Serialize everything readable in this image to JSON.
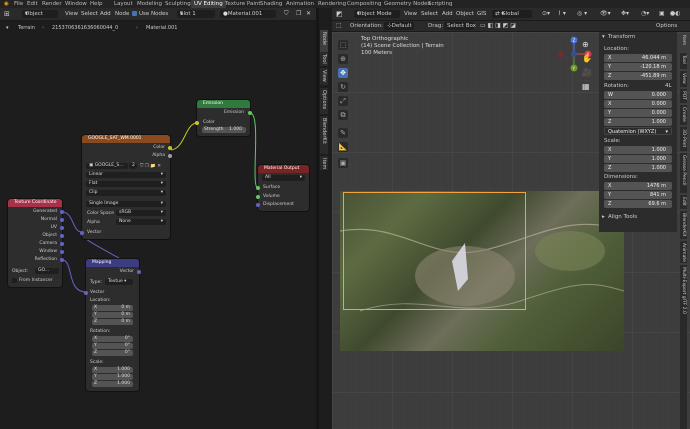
{
  "menu": {
    "file": "File",
    "edit": "Edit",
    "render": "Render",
    "window": "Window",
    "help": "Help"
  },
  "workspaces": [
    "Layout",
    "Modeling",
    "Sculpting",
    "UV Editing",
    "Texture Paint",
    "Shading",
    "Animation",
    "Rendering",
    "Compositing",
    "Geometry Nodes",
    "Scripting"
  ],
  "node_editor": {
    "header": {
      "mode": "Object",
      "view": "View",
      "select": "Select",
      "add": "Add",
      "node": "Node",
      "use_nodes": "Use Nodes",
      "slot": "Slot 1",
      "material": "Material.001"
    },
    "breadcrumb": {
      "object": "Terrain",
      "mesh": "2153706361636060044_0",
      "material": "Material.001"
    },
    "nodes": {
      "emission": {
        "title": "Emission",
        "out": "Emission",
        "color": "Color",
        "strength_label": "Strength",
        "strength": "1.000"
      },
      "image": {
        "title": "GOOGLE_SAT_WM.0001",
        "color": "Color",
        "alpha": "Alpha",
        "image_name": "GOOGLE_S...",
        "users": "2",
        "interp": "Linear",
        "proj": "Flat",
        "ext": "Clip",
        "source": "Single Image",
        "cs_label": "Color Space",
        "cs": "sRGB",
        "alpha_label": "Alpha",
        "alpha_val": "None",
        "vector": "Vector"
      },
      "texcoord": {
        "title": "Texture Coordinate",
        "outs": [
          "Generated",
          "Normal",
          "UV",
          "Object",
          "Camera",
          "Window",
          "Reflection"
        ],
        "object_label": "Object:",
        "object_val": "GO...",
        "from_instancer": "From Instancer"
      },
      "output": {
        "title": "Material Output",
        "target": "All",
        "ins": [
          "Surface",
          "Volume",
          "Displacement"
        ]
      },
      "mapping": {
        "title": "Mapping",
        "vector_out": "Vector",
        "type_label": "Type:",
        "type": "Textue",
        "vector_in": "Vector",
        "location": "Location:",
        "rotation": "Rotation:",
        "scale": "Scale:",
        "loc": [
          [
            "X",
            "0 m"
          ],
          [
            "Y",
            "0 m"
          ],
          [
            "Z",
            "0 m"
          ]
        ],
        "rot": [
          [
            "X",
            "0°"
          ],
          [
            "Y",
            "0°"
          ],
          [
            "Z",
            "0°"
          ]
        ],
        "scl": [
          [
            "X",
            "1.000"
          ],
          [
            "Y",
            "1.000"
          ],
          [
            "Z",
            "1.000"
          ]
        ]
      }
    }
  },
  "viewport": {
    "header": {
      "mode": "Object Mode",
      "view": "View",
      "select": "Select",
      "add": "Add",
      "object": "Object",
      "gis": "GIS",
      "global": "Global",
      "options": "Options"
    },
    "header2": {
      "orientation_label": "Orientation:",
      "orientation": "Default",
      "drag_label": "Drag:",
      "drag": "Select Box"
    },
    "overlay": {
      "view_name": "Top Orthographic",
      "collection": "(14) Scene Collection | Terrain",
      "scale": "100 Meters"
    },
    "gizmo": {
      "z": "Z",
      "x": "X",
      "y": "Y"
    }
  },
  "npanel": {
    "transform": "Transform",
    "location": "Location:",
    "loc": [
      [
        "X",
        "46.044 m"
      ],
      [
        "Y",
        "-120.18 m"
      ],
      [
        "Z",
        "-451.89 m"
      ]
    ],
    "rotation": "Rotation:",
    "rot_mode": "4L",
    "rot": [
      [
        "W",
        "0.000"
      ],
      [
        "X",
        "0.000"
      ],
      [
        "Y",
        "0.000"
      ],
      [
        "Z",
        "1.000"
      ]
    ],
    "rot_type": "Quaternion (WXYZ)",
    "scale": "Scale:",
    "scl": [
      [
        "X",
        "1.000"
      ],
      [
        "Y",
        "1.000"
      ],
      [
        "Z",
        "1.000"
      ]
    ],
    "dimensions": "Dimensions:",
    "dim": [
      [
        "X",
        "1476 m"
      ],
      [
        "Y",
        "841 m"
      ],
      [
        "Z",
        "69.6 m"
      ]
    ],
    "align": "Align Tools"
  },
  "node_sidetabs": [
    "Node",
    "Tool",
    "View",
    "Options",
    "BlenderKit",
    "Item"
  ],
  "npanel_tabs": [
    "Item",
    "Tool",
    "View",
    "PDT",
    "Create",
    "3D-Print",
    "Grease Pencil",
    "Edit",
    "BlenderKit",
    "Animate",
    "Multi-Export glTF 2.0"
  ]
}
